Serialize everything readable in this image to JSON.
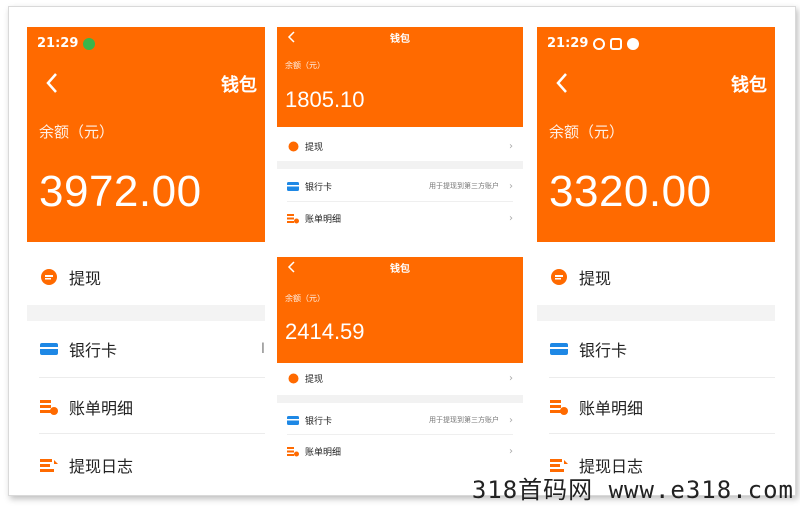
{
  "left": {
    "status_time": "21:29",
    "title": "钱包",
    "balance_label": "余额（元）",
    "balance": "3972.00",
    "withdraw": "提现",
    "bank_card": "银行卡",
    "bill": "账单明细",
    "withdraw_log": "提现日志",
    "cut_text": "Ⅰ"
  },
  "mid_top": {
    "title": "钱包",
    "balance_label": "余额（元）",
    "balance": "1805.10",
    "withdraw": "提现",
    "bank_card": "银行卡",
    "bank_hint": "用于提现到第三方账户",
    "bill": "账单明细"
  },
  "mid_bottom": {
    "title": "钱包",
    "balance_label": "余额（元）",
    "balance": "2414.59",
    "withdraw": "提现",
    "bank_card": "银行卡",
    "bank_hint": "用于提现到第三方账户",
    "bill": "账单明细"
  },
  "right": {
    "status_time": "21:29",
    "title": "钱包",
    "balance_label": "余额（元）",
    "balance": "3320.00",
    "withdraw": "提现",
    "bank_card": "银行卡",
    "bill": "账单明细",
    "withdraw_log": "提现日志"
  },
  "watermark": "318首码网  www.e318.com",
  "colors": {
    "accent": "#ff6a00",
    "bank_icon": "#1e88e5"
  }
}
